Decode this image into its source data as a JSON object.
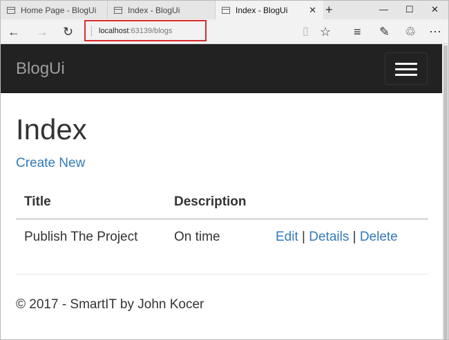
{
  "browser": {
    "tabs": [
      {
        "label": "Home Page - BlogUi"
      },
      {
        "label": "Index - BlogUi"
      },
      {
        "label": "Index - BlogUi"
      }
    ],
    "new_tab": "+",
    "window": {
      "minimize": "—",
      "maximize": "☐",
      "close": "✕"
    },
    "address": {
      "host": "localhost",
      "rest": ":63139/blogs"
    },
    "icons": [
      "back-icon",
      "forward-icon",
      "refresh-icon",
      "reading-view-icon",
      "favorite-star-icon",
      "hub-icon",
      "web-note-icon",
      "share-icon",
      "more-icon"
    ]
  },
  "site": {
    "brand": "BlogUi",
    "page_title": "Index",
    "create_link": "Create New",
    "table": {
      "headers": [
        "Title",
        "Description",
        ""
      ],
      "rows": [
        {
          "title": "Publish The Project",
          "description": "On time",
          "edit": "Edit",
          "details": "Details",
          "delete": "Delete",
          "sep": "|"
        }
      ]
    },
    "footer": "© 2017 - SmartIT by John Kocer"
  },
  "colors": {
    "navbar": "#222222",
    "link": "#337ab7",
    "highlight": "#d92b2b"
  }
}
